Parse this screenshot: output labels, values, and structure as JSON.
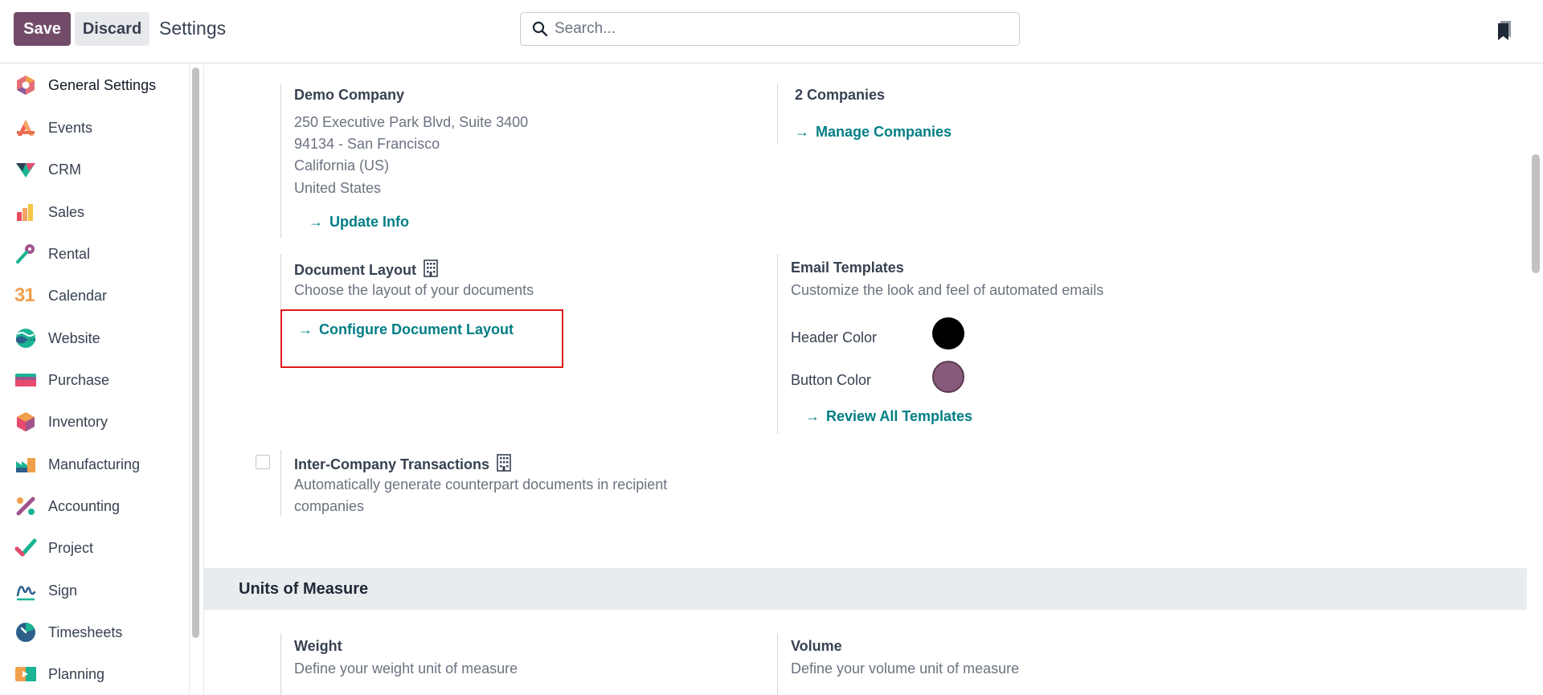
{
  "toolbar": {
    "save_label": "Save",
    "discard_label": "Discard",
    "page_title": "Settings"
  },
  "search": {
    "placeholder": "Search..."
  },
  "sidebar": {
    "items": [
      {
        "label": "General Settings",
        "icon": "general-settings-icon"
      },
      {
        "label": "Events",
        "icon": "events-icon"
      },
      {
        "label": "CRM",
        "icon": "crm-icon"
      },
      {
        "label": "Sales",
        "icon": "sales-icon"
      },
      {
        "label": "Rental",
        "icon": "rental-icon"
      },
      {
        "label": "Calendar",
        "icon": "calendar-icon"
      },
      {
        "label": "Website",
        "icon": "website-icon"
      },
      {
        "label": "Purchase",
        "icon": "purchase-icon"
      },
      {
        "label": "Inventory",
        "icon": "inventory-icon"
      },
      {
        "label": "Manufacturing",
        "icon": "manufacturing-icon"
      },
      {
        "label": "Accounting",
        "icon": "accounting-icon"
      },
      {
        "label": "Project",
        "icon": "project-icon"
      },
      {
        "label": "Sign",
        "icon": "sign-icon"
      },
      {
        "label": "Timesheets",
        "icon": "timesheets-icon"
      },
      {
        "label": "Planning",
        "icon": "planning-icon"
      }
    ],
    "calendar_day": "31"
  },
  "company": {
    "name": "Demo Company",
    "address_line1": "250 Executive Park Blvd, Suite 3400",
    "address_line2": "94134 - San Francisco",
    "address_line3": "California (US)",
    "address_line4": "United States",
    "update_link": "Update Info"
  },
  "companies": {
    "title": "2 Companies",
    "manage_link": "Manage Companies"
  },
  "document_layout": {
    "title": "Document Layout",
    "description": "Choose the layout of your documents",
    "configure_link": "Configure Document Layout"
  },
  "email_templates": {
    "title": "Email Templates",
    "description": "Customize the look and feel of automated emails",
    "header_color_label": "Header Color",
    "header_color": "#000000",
    "button_color_label": "Button Color",
    "button_color": "#875a7b",
    "review_link": "Review All Templates"
  },
  "inter_company": {
    "title": "Inter-Company Transactions",
    "description_line1": "Automatically generate counterpart documents in recipient",
    "description_line2": "companies",
    "checked": false
  },
  "units": {
    "section_title": "Units of Measure",
    "weight_title": "Weight",
    "weight_desc": "Define your weight unit of measure",
    "volume_title": "Volume",
    "volume_desc": "Define your volume unit of measure"
  },
  "colors": {
    "brand": "#714b67",
    "link": "#017e84",
    "highlight": "#e0161b"
  }
}
